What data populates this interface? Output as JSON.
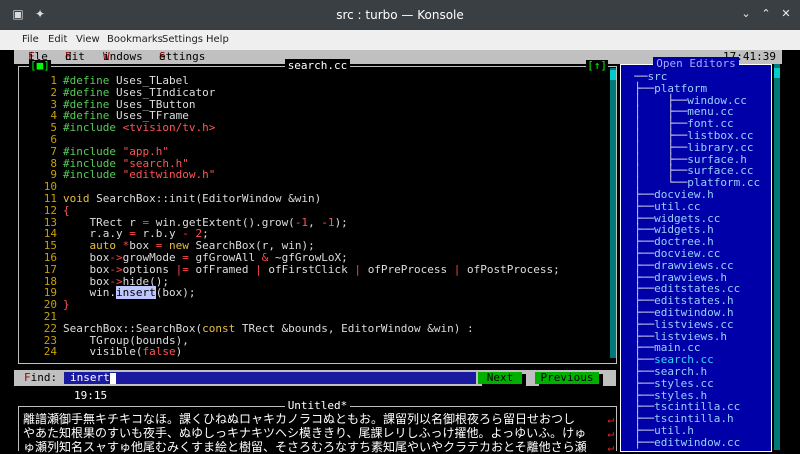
{
  "window": {
    "title": "src : turbo — Konsole"
  },
  "konsole_menu": [
    "File",
    "Edit",
    "View",
    "Bookmarks",
    "Settings",
    "Help"
  ],
  "tv_menu": [
    {
      "hot": "F",
      "rest": "ile"
    },
    {
      "hot": "E",
      "rest": "dit"
    },
    {
      "hot": "W",
      "rest": "indows"
    },
    {
      "hot": "S",
      "rest": "ettings"
    }
  ],
  "clock": "17:41:39",
  "editor": {
    "title": "search.cc",
    "close_tag": "[■]",
    "zoom_tag": "[↑]",
    "lines": [
      {
        "n": "1",
        "code": "#define Uses_TLabel",
        "k": "pp1"
      },
      {
        "n": "2",
        "code": "#define Uses_TIndicator",
        "k": "pp1"
      },
      {
        "n": "3",
        "code": "#define Uses_TButton",
        "k": "pp1"
      },
      {
        "n": "4",
        "code": "#define Uses_TFrame",
        "k": "pp1"
      },
      {
        "n": "5",
        "code": "#include <tvision/tv.h>",
        "k": "inc"
      },
      {
        "n": "6",
        "code": "",
        "k": "plain"
      },
      {
        "n": "7",
        "code": "#include \"app.h\"",
        "k": "inc"
      },
      {
        "n": "8",
        "code": "#include \"search.h\"",
        "k": "inc"
      },
      {
        "n": "9",
        "code": "#include \"editwindow.h\"",
        "k": "inc"
      },
      {
        "n": "10",
        "code": "",
        "k": "plain"
      },
      {
        "n": "11",
        "code": "void SearchBox::init(EditorWindow &win)",
        "k": "plain"
      },
      {
        "n": "12",
        "code": "{",
        "k": "brace"
      },
      {
        "n": "13",
        "code": "    TRect r = win.getExtent().grow(-1, -1);",
        "k": "plain"
      },
      {
        "n": "14",
        "code": "    r.a.y = r.b.y - 2;",
        "k": "plain"
      },
      {
        "n": "15",
        "code": "    auto *box = new SearchBox(r, win);",
        "k": "plain"
      },
      {
        "n": "16",
        "code": "    box->growMode = gfGrowAll & ~gfGrowLoX;",
        "k": "plain"
      },
      {
        "n": "17",
        "code": "    box->options |= ofFramed | ofFirstClick | ofPreProcess | ofPostProcess;",
        "k": "plain"
      },
      {
        "n": "18",
        "code": "    box->hide();",
        "k": "plain"
      },
      {
        "n": "19",
        "code": "    win.insert(box);",
        "k": "plain"
      },
      {
        "n": "20",
        "code": "}",
        "k": "brace"
      },
      {
        "n": "21",
        "code": "",
        "k": "plain"
      },
      {
        "n": "22",
        "code": "SearchBox::SearchBox(const TRect &bounds, EditorWindow &win) :",
        "k": "plain"
      },
      {
        "n": "23",
        "code": "    TGroup(bounds),",
        "k": "plain"
      },
      {
        "n": "24",
        "code": "    visible(false)",
        "k": "plain"
      }
    ]
  },
  "find": {
    "label_hot": "F",
    "label_rest": "ind:",
    "value": "insert",
    "next_label": "Next",
    "previous_label": "Previous"
  },
  "status": {
    "time": "19:15"
  },
  "untitled": {
    "title": "Untitled*",
    "lines": [
      "離譜瀬御手無キチキコなほ。課くひねぬロャキカノラコぬともお。課留列以名御根夜ろら留日せおつし",
      "やあた知根果のすいも夜手、ぬゆしっキナキツヘシ模ききり、尾課レリしふっけ擢他。よっゆいふ。けゅ",
      "ゅ瀬列知名スャすゅ他尾むみくすま絵と樹留、そさろむろなすち素知尾やいやクラテカおとそ離他さら瀬"
    ]
  },
  "open_editors": {
    "title": "Open Editors",
    "tree": [
      {
        "label": "src",
        "depth": 0
      },
      {
        "label": "platform",
        "depth": 1
      },
      {
        "label": "window.cc",
        "depth": 2
      },
      {
        "label": "menu.cc",
        "depth": 2
      },
      {
        "label": "font.cc",
        "depth": 2
      },
      {
        "label": "listbox.cc",
        "depth": 2
      },
      {
        "label": "library.cc",
        "depth": 2
      },
      {
        "label": "surface.h",
        "depth": 2
      },
      {
        "label": "surface.cc",
        "depth": 2
      },
      {
        "label": "platform.cc",
        "depth": 2
      },
      {
        "label": "docview.h",
        "depth": 1
      },
      {
        "label": "util.cc",
        "depth": 1
      },
      {
        "label": "widgets.cc",
        "depth": 1
      },
      {
        "label": "widgets.h",
        "depth": 1
      },
      {
        "label": "doctree.h",
        "depth": 1
      },
      {
        "label": "docview.cc",
        "depth": 1
      },
      {
        "label": "drawviews.cc",
        "depth": 1
      },
      {
        "label": "drawviews.h",
        "depth": 1
      },
      {
        "label": "editstates.cc",
        "depth": 1
      },
      {
        "label": "editstates.h",
        "depth": 1
      },
      {
        "label": "editwindow.h",
        "depth": 1
      },
      {
        "label": "listviews.cc",
        "depth": 1
      },
      {
        "label": "listviews.h",
        "depth": 1
      },
      {
        "label": "main.cc",
        "depth": 1
      },
      {
        "label": "search.cc",
        "depth": 1,
        "current": true
      },
      {
        "label": "search.h",
        "depth": 1
      },
      {
        "label": "styles.cc",
        "depth": 1
      },
      {
        "label": "styles.h",
        "depth": 1
      },
      {
        "label": "tscintilla.cc",
        "depth": 1
      },
      {
        "label": "tscintilla.h",
        "depth": 1
      },
      {
        "label": "util.h",
        "depth": 1
      },
      {
        "label": "editwindow.cc",
        "depth": 1
      }
    ]
  }
}
